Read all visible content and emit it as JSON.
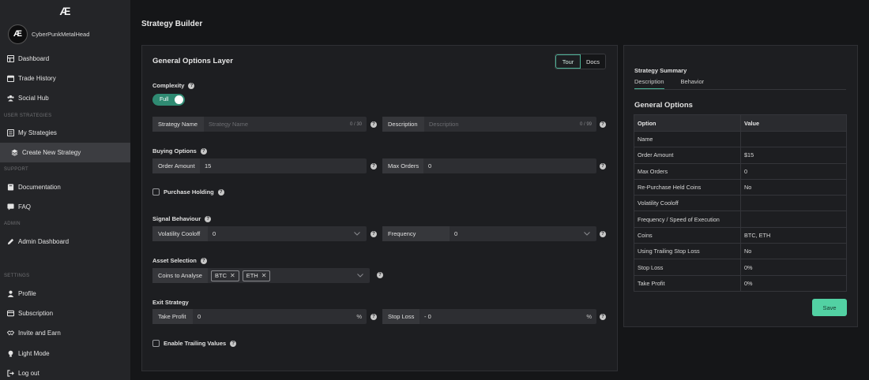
{
  "app": {
    "logo": "Æ",
    "username": "CyberPunkMetalHead"
  },
  "sidebar": {
    "items": [
      {
        "label": "Dashboard",
        "icon": "dashboard-icon"
      },
      {
        "label": "Trade History",
        "icon": "calendar-icon"
      },
      {
        "label": "Social Hub",
        "icon": "users-icon"
      },
      {
        "label": "My Strategies",
        "icon": "list-icon"
      },
      {
        "label": "Create New Strategy",
        "icon": "layers-icon",
        "active": true
      },
      {
        "label": "Documentation",
        "icon": "book-icon"
      },
      {
        "label": "FAQ",
        "icon": "chat-icon"
      },
      {
        "label": "Admin Dashboard",
        "icon": "pencil-icon"
      },
      {
        "label": "Profile",
        "icon": "user-icon"
      },
      {
        "label": "Subscription",
        "icon": "card-icon"
      },
      {
        "label": "Invite and Earn",
        "icon": "handshake-icon"
      },
      {
        "label": "Light Mode",
        "icon": "lightbulb-icon"
      },
      {
        "label": "Log out",
        "icon": "logout-icon"
      }
    ],
    "sections": [
      "USER STRATEGIES",
      "SUPPORT",
      "ADMIN",
      "SETTINGS"
    ]
  },
  "page": {
    "title": "Strategy Builder"
  },
  "builder": {
    "title": "General Options Layer",
    "tour_label": "Tour",
    "docs_label": "Docs",
    "complexity_label": "Complexity",
    "complexity_value": "Full",
    "strategy_name": {
      "label": "Strategy Name",
      "placeholder": "Strategy Name",
      "counter": "0 / 30"
    },
    "description": {
      "label": "Description",
      "placeholder": "Description",
      "counter": "0 / 99"
    },
    "buying_options_label": "Buying Options",
    "order_amount": {
      "label": "Order Amount",
      "value": "15"
    },
    "max_orders": {
      "label": "Max Orders",
      "value": "0"
    },
    "purchase_holding_label": "Purchase Holding",
    "signal_behaviour_label": "Signal Behaviour",
    "volatility_cooloff": {
      "label": "Volatility Cooloff",
      "value": "0"
    },
    "frequency": {
      "label": "Frequency",
      "value": "0"
    },
    "asset_selection_label": "Asset Selection",
    "coins": {
      "label": "Coins to Analyse",
      "tags": [
        "BTC",
        "ETH"
      ]
    },
    "exit_strategy_label": "Exit Strategy",
    "take_profit": {
      "label": "Take Profit",
      "value": "0",
      "suffix": "%"
    },
    "stop_loss": {
      "label": "Stop Loss",
      "value": "- 0",
      "suffix": "%"
    },
    "trailing_label": "Enable Trailing Values"
  },
  "summary": {
    "title": "Strategy Summary",
    "tabs": [
      "Description",
      "Behavior"
    ],
    "section": "General Options",
    "columns": [
      "Option",
      "Value"
    ],
    "rows": [
      [
        "Name",
        ""
      ],
      [
        "Order Amount",
        "$15"
      ],
      [
        "Max Orders",
        "0"
      ],
      [
        "Re-Purchase Held Coins",
        "No"
      ],
      [
        "Volatility Cooloff",
        ""
      ],
      [
        "Frequency / Speed of Execution",
        ""
      ],
      [
        "Coins",
        "BTC, ETH"
      ],
      [
        "Using Trailing Stop Loss",
        "No"
      ],
      [
        "Stop Loss",
        "0%"
      ],
      [
        "Take Profit",
        "0%"
      ]
    ],
    "save_label": "Save"
  },
  "colors": {
    "accent": "#52d1a3",
    "toggle": "#2f8a72",
    "sidebar": "#242528",
    "background": "#151618"
  }
}
